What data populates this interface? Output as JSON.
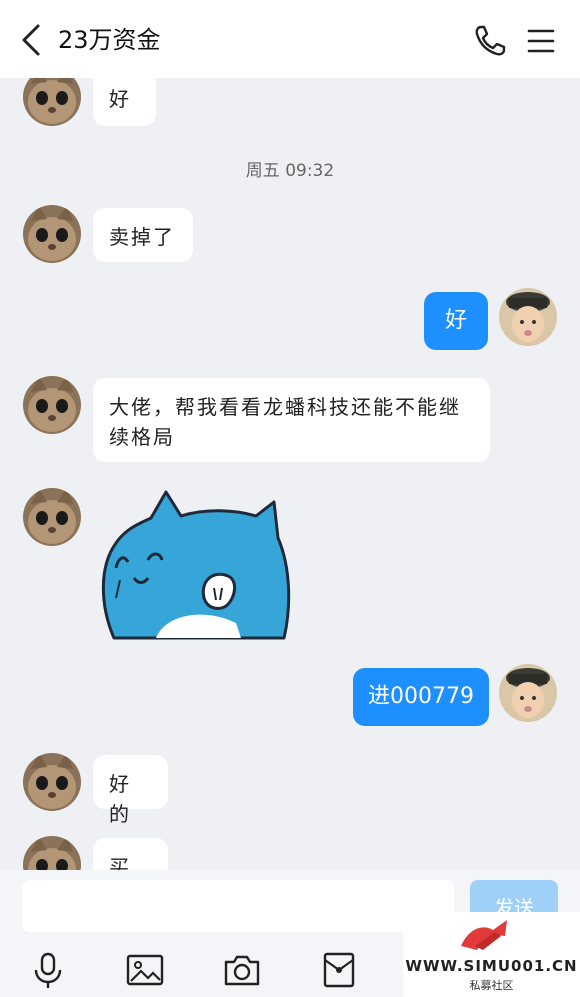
{
  "header": {
    "title": "23万资金",
    "back_icon": "chevron-left-icon",
    "call_icon": "phone-icon",
    "menu_icon": "menu-icon"
  },
  "messages": [
    {
      "side": "left",
      "text": "好"
    },
    {
      "type": "timestamp",
      "text": "周五 09:32"
    },
    {
      "side": "left",
      "text": "卖掉了"
    },
    {
      "side": "right",
      "text": "好"
    },
    {
      "side": "left",
      "text": "大佬，帮我看看龙蟠科技还能不能继续格局"
    },
    {
      "side": "left",
      "type": "sticker",
      "icon": "blue-cat-sticker"
    },
    {
      "side": "right",
      "text": "进000779"
    },
    {
      "side": "left",
      "text": "好的"
    },
    {
      "side": "left",
      "text": "买了"
    }
  ],
  "input_bar": {
    "value": "",
    "send_label": "发送",
    "tools": [
      "microphone-icon",
      "image-icon",
      "camera-icon",
      "red-packet-icon"
    ]
  },
  "watermark": {
    "text": "WWW.SIMU001.CN",
    "sub": "私募社区"
  },
  "colors": {
    "accent": "#1e8fff",
    "background": "#eef0f4",
    "send_disabled": "#9fd0f7"
  }
}
